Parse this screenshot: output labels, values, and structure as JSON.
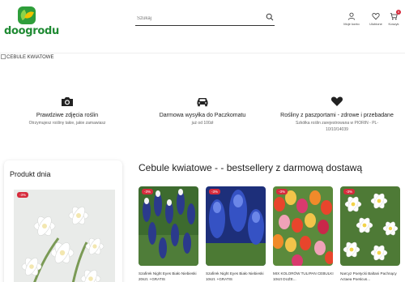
{
  "header": {
    "logo_text": "doogrodu",
    "search_placeholder": "Szukaj",
    "icons": [
      {
        "name": "account",
        "label": "Moje konto"
      },
      {
        "name": "wishlist",
        "label": "Ulubione"
      },
      {
        "name": "cart",
        "label": "Koszyk",
        "badge": "0"
      }
    ]
  },
  "banner": {
    "alt": "CEBULE KWIATOWE"
  },
  "features": [
    {
      "icon": "camera-icon",
      "title": "Prawdziwe zdjęcia roślin",
      "subtitle": "Otrzymujesz rośliny takie, jakie zamawiasz"
    },
    {
      "icon": "truck-icon",
      "title": "Darmowa wysyłka do Paczkomatu",
      "subtitle": "już od 100zł"
    },
    {
      "icon": "heart-icon",
      "title": "Rośliny z paszportami - zdrowe i przebadane",
      "subtitle": "Szkółka roślin zarejestrowana w PIORIN - PL-10/10/14039"
    }
  ],
  "product_of_day": {
    "title": "Produkt dnia",
    "discount": "-3%"
  },
  "bestsellers": {
    "title": "Cebule kwiatowe - - bestsellery z darmową dostawą",
    "products": [
      {
        "name": "Szafirek Night Eyes Biało Niebieski 20szt. +GRATIS",
        "discount": "-3%"
      },
      {
        "name": "Szafirek Night Eyes Biało Niebieski 10szt. +GRATIS",
        "discount": "-3%"
      },
      {
        "name": "MIX KOLORÓW TULIPAN CEBULKI 10szt DUŻE...",
        "discount": "-3%"
      },
      {
        "name": "Narcyz Poetycki Baltani Pachnący Actaea Poeticus...",
        "discount": "-3%"
      }
    ]
  },
  "colors": {
    "brand_green": "#2e9e3a",
    "discount_red": "#d62b3c"
  }
}
